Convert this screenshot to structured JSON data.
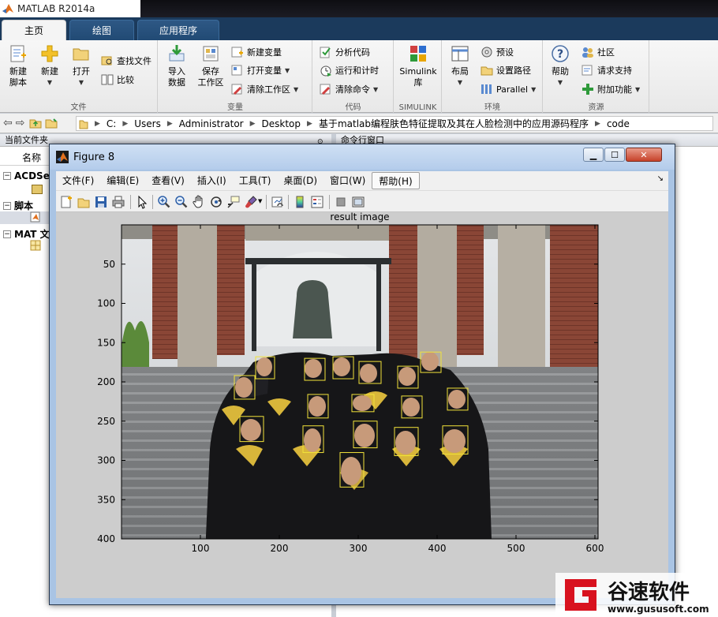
{
  "app": {
    "title": "MATLAB R2014a"
  },
  "tabs": [
    {
      "label": "主页",
      "active": true
    },
    {
      "label": "绘图",
      "active": false
    },
    {
      "label": "应用程序",
      "active": false
    }
  ],
  "ribbon": {
    "file": {
      "label": "文件",
      "new_script": [
        "新建",
        "脚本"
      ],
      "new": "新建",
      "open": "打开",
      "find_files": "查找文件",
      "compare": "比较"
    },
    "variable": {
      "label": "变量",
      "import": [
        "导入",
        "数据"
      ],
      "save_ws": [
        "保存",
        "工作区"
      ],
      "new_var": "新建变量",
      "open_var": "打开变量",
      "clear_ws": "清除工作区"
    },
    "code": {
      "label": "代码",
      "analyze": "分析代码",
      "run_time": "运行和计时",
      "clear_cmd": "清除命令"
    },
    "simulink": {
      "label": "SIMULINK",
      "lib": [
        "Simulink",
        "库"
      ]
    },
    "env": {
      "label": "环境",
      "layout": "布局",
      "prefs": "预设",
      "set_path": "设置路径",
      "parallel": "Parallel"
    },
    "resources": {
      "label": "资源",
      "help": "帮助",
      "community": "社区",
      "support": "请求支持",
      "addons": "附加功能"
    }
  },
  "address": {
    "segments": [
      "C:",
      "Users",
      "Administrator",
      "Desktop",
      "基于matlab编程肤色特征提取及其在人脸检测中的应用源码程序",
      "code"
    ]
  },
  "left_panel": {
    "header": "当前文件夹",
    "col_name": "名称",
    "groups": [
      "ACDSee",
      "脚本",
      "MAT 文"
    ]
  },
  "right_panel": {
    "header": "命令行窗口"
  },
  "figure": {
    "title": "Figure 8",
    "menus": [
      "文件(F)",
      "编辑(E)",
      "查看(V)",
      "插入(I)",
      "工具(T)",
      "桌面(D)",
      "窗口(W)",
      "帮助(H)"
    ]
  },
  "chart_data": {
    "type": "image",
    "title": "result image",
    "xlabel": "",
    "ylabel": "",
    "xlim": [
      0,
      604
    ],
    "ylim": [
      400,
      0
    ],
    "xticks": [
      100,
      200,
      300,
      400,
      500,
      600
    ],
    "yticks": [
      50,
      100,
      150,
      200,
      250,
      300,
      350,
      400
    ],
    "detection_boxes": [
      {
        "x": 170,
        "y": 168,
        "w": 24,
        "h": 28
      },
      {
        "x": 232,
        "y": 170,
        "w": 26,
        "h": 28
      },
      {
        "x": 268,
        "y": 168,
        "w": 26,
        "h": 28
      },
      {
        "x": 301,
        "y": 174,
        "w": 28,
        "h": 28
      },
      {
        "x": 379,
        "y": 162,
        "w": 26,
        "h": 26
      },
      {
        "x": 350,
        "y": 180,
        "w": 26,
        "h": 28
      },
      {
        "x": 143,
        "y": 192,
        "w": 26,
        "h": 30
      },
      {
        "x": 236,
        "y": 216,
        "w": 26,
        "h": 30
      },
      {
        "x": 292,
        "y": 216,
        "w": 28,
        "h": 22
      },
      {
        "x": 355,
        "y": 218,
        "w": 26,
        "h": 28
      },
      {
        "x": 413,
        "y": 208,
        "w": 26,
        "h": 28
      },
      {
        "x": 150,
        "y": 244,
        "w": 30,
        "h": 32
      },
      {
        "x": 230,
        "y": 256,
        "w": 26,
        "h": 34
      },
      {
        "x": 294,
        "y": 250,
        "w": 30,
        "h": 34
      },
      {
        "x": 346,
        "y": 258,
        "w": 30,
        "h": 36
      },
      {
        "x": 407,
        "y": 256,
        "w": 32,
        "h": 36
      },
      {
        "x": 277,
        "y": 290,
        "w": 30,
        "h": 44
      }
    ]
  }
}
